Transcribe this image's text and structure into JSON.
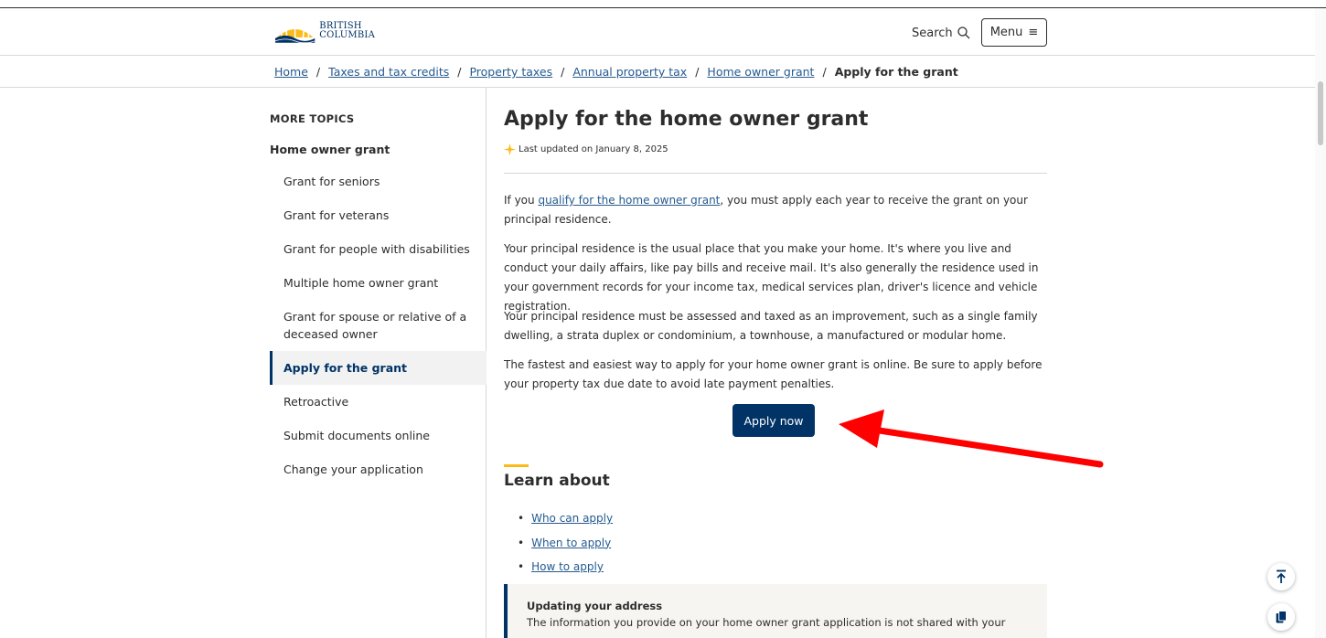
{
  "header": {
    "logo_line1": "BRITISH",
    "logo_line2": "COLUMBIA",
    "search_label": "Search",
    "menu_label": "Menu",
    "menu_icon": "≡"
  },
  "breadcrumb": {
    "items": [
      "Home",
      "Taxes and tax credits",
      "Property taxes",
      "Annual property tax",
      "Home owner grant"
    ],
    "current": "Apply for the grant",
    "separator": "/"
  },
  "sidebar": {
    "heading": "MORE TOPICS",
    "parent": "Home owner grant",
    "items": [
      "Grant for seniors",
      "Grant for veterans",
      "Grant for people with disabilities",
      "Multiple home owner grant",
      "Grant for spouse or relative of a deceased owner",
      "Apply for the grant",
      "Retroactive",
      "Submit documents online",
      "Change your application"
    ],
    "active_index": 5
  },
  "main": {
    "title": "Apply for the home owner grant",
    "updated": "Last updated on January 8, 2025",
    "p1_prefix": "If you ",
    "p1_link": "qualify for the home owner grant",
    "p1_suffix": ", you must apply each year to receive the grant on your principal residence.",
    "p2": "Your principal residence is the usual place that you make your home. It's where you live and conduct your daily affairs, like pay bills and receive mail. It's also generally the residence used in your government records for your income tax, medical services plan, driver's licence and vehicle registration.",
    "p3": "Your principal residence must be assessed and taxed as an improvement, such as a single family dwelling, a strata duplex or condominium, a townhouse, a manufactured or modular home.",
    "p4": "The fastest and easiest way to apply for your home owner grant is online. Be sure to apply before your property tax due date to avoid late payment penalties.",
    "apply_button": "Apply now",
    "learn_title": "Learn about",
    "learn_links": [
      "Who can apply",
      "When to apply",
      "How to apply"
    ],
    "callout_title": "Updating your address",
    "callout_text": "The information you provide on your home owner grant application is not shared with your"
  },
  "colors": {
    "brand_navy": "#013366",
    "accent_gold": "#fcba19",
    "link": "#255a90",
    "annotation_arrow": "#ff0000"
  },
  "icons": {
    "search": "search-icon",
    "menu": "hamburger-icon",
    "updated": "sparkle-icon",
    "back_to_top": "arrow-up-icon",
    "copy": "copy-icon",
    "annotation": "red-arrow"
  }
}
